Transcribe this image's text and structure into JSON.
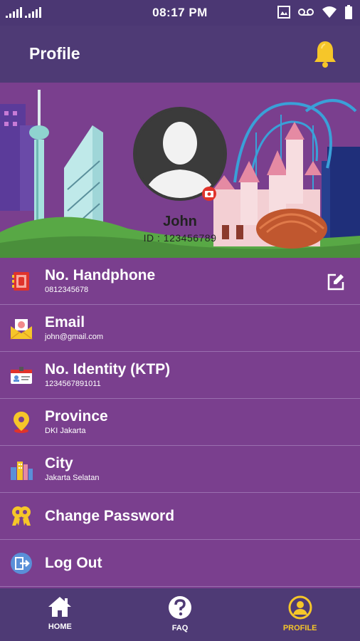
{
  "status_bar": {
    "time": "08:17 PM"
  },
  "header": {
    "title": "Profile",
    "icon": "bell-icon",
    "accent": "#f6c629"
  },
  "profile": {
    "name": "John",
    "id_text": "ID : 123456789"
  },
  "menu": [
    {
      "title": "No. Handphone",
      "value": "0812345678",
      "icon": "phone-book-icon"
    },
    {
      "title": "Email",
      "value": "john@gmail.com",
      "icon": "envelope-icon"
    },
    {
      "title": "No. Identity (KTP)",
      "value": "1234567891011",
      "icon": "id-card-icon"
    },
    {
      "title": "Province",
      "value": "DKI Jakarta",
      "icon": "location-pin-icon"
    },
    {
      "title": "City",
      "value": "Jakarta Selatan",
      "icon": "city-icon"
    },
    {
      "title": "Change Password",
      "icon": "key-icon"
    },
    {
      "title": "Log Out",
      "icon": "logout-icon"
    }
  ],
  "bottom_nav": [
    {
      "label": "HOME",
      "icon": "home-icon"
    },
    {
      "label": "FAQ",
      "icon": "question-icon"
    },
    {
      "label": "PROFILE",
      "icon": "profile-icon",
      "active": true
    }
  ]
}
